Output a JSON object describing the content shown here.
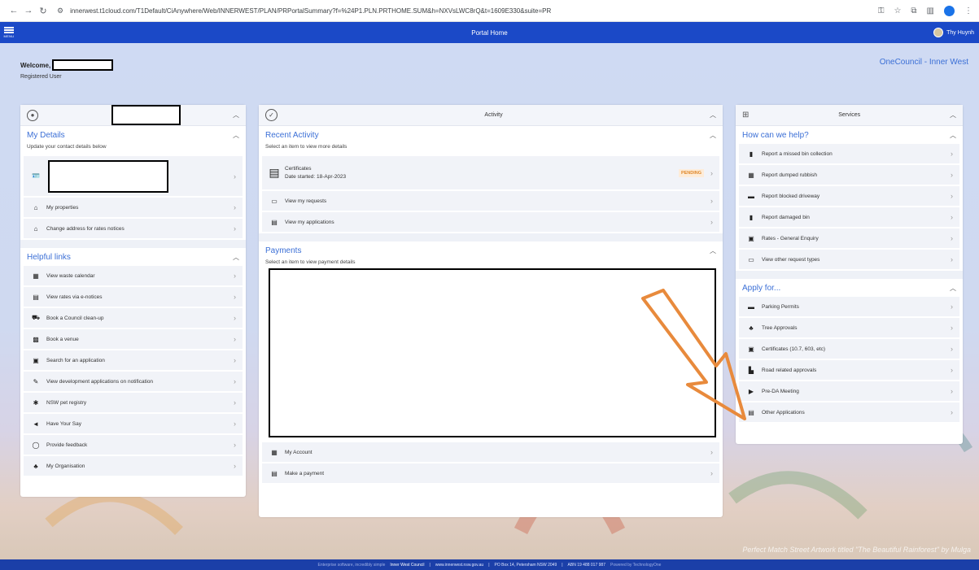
{
  "browser": {
    "url": "innerwest.t1cloud.com/T1Default/CiAnywhere/Web/INNERWEST/PLAN/PRPortalSummary?f=%24P1.PLN.PRTHOME.SUM&h=NXVsLWC8rQ&t=1609E330&suite=PR",
    "back_icon": "back-arrow-icon",
    "forward_icon": "forward-arrow-icon",
    "reload_icon": "reload-icon"
  },
  "appbar": {
    "menu_label": "MENU",
    "title": "Portal Home",
    "user_name": "Thy Huynh"
  },
  "welcome": {
    "greeting": "Welcome,",
    "role": "Registered User"
  },
  "brand": "OneCouncil - Inner West",
  "left": {
    "my_details": {
      "title": "My Details",
      "subtitle": "Update your contact details below",
      "items": [
        {
          "label": "My properties",
          "icon": "house-icon"
        },
        {
          "label": "Change address for rates notices",
          "icon": "house-move-icon"
        }
      ]
    },
    "helpful_links": {
      "title": "Helpful links",
      "items": [
        {
          "label": "View waste calendar",
          "icon": "calendar-icon"
        },
        {
          "label": "View rates via e-notices",
          "icon": "enotice-icon"
        },
        {
          "label": "Book a Council clean-up",
          "icon": "truck-icon"
        },
        {
          "label": "Book a venue",
          "icon": "venue-icon"
        },
        {
          "label": "Search for an application",
          "icon": "document-search-icon"
        },
        {
          "label": "View development applications on notification",
          "icon": "edit-icon"
        },
        {
          "label": "NSW pet registry",
          "icon": "paw-icon"
        },
        {
          "label": "Have Your Say",
          "icon": "megaphone-icon"
        },
        {
          "label": "Provide feedback",
          "icon": "chat-icon"
        },
        {
          "label": "My Organisation",
          "icon": "organisation-icon"
        }
      ]
    }
  },
  "middle": {
    "panel_title": "Activity",
    "recent": {
      "title": "Recent Activity",
      "subtitle": "Select an item to view more details",
      "certificate_title": "Certificates",
      "certificate_date": "Date started: 18-Apr-2023",
      "certificate_status": "PENDING",
      "items": [
        {
          "label": "View my requests",
          "icon": "requests-icon"
        },
        {
          "label": "View my applications",
          "icon": "applications-icon"
        }
      ]
    },
    "payments": {
      "title": "Payments",
      "subtitle": "Select an item to view payment details",
      "items": [
        {
          "label": "My Account",
          "icon": "account-icon"
        },
        {
          "label": "Make a payment",
          "icon": "payment-icon"
        }
      ]
    }
  },
  "right": {
    "panel_title": "Services",
    "help": {
      "title": "How can we help?",
      "items": [
        {
          "label": "Report a missed bin collection",
          "icon": "bin-icon"
        },
        {
          "label": "Report dumped rubbish",
          "icon": "rubbish-icon"
        },
        {
          "label": "Report blocked driveway",
          "icon": "car-icon"
        },
        {
          "label": "Report damaged bin",
          "icon": "damaged-bin-icon"
        },
        {
          "label": "Rates - General Enquiry",
          "icon": "rates-icon"
        },
        {
          "label": "View other request types",
          "icon": "request-types-icon"
        }
      ]
    },
    "apply": {
      "title": "Apply for...",
      "items": [
        {
          "label": "Parking Permits",
          "icon": "car-icon"
        },
        {
          "label": "Tree Approvals",
          "icon": "tree-icon"
        },
        {
          "label": "Certificates (10.7, 603, etc)",
          "icon": "certificate-icon"
        },
        {
          "label": "Road related approvals",
          "icon": "road-icon"
        },
        {
          "label": "Pre-DA Meeting",
          "icon": "meeting-icon"
        },
        {
          "label": "Other Applications",
          "icon": "applications-icon"
        }
      ]
    }
  },
  "footer": {
    "tagline": "Enterprise software, incredibly simple",
    "council": "Inner West Council",
    "website": "www.innerwest.nsw.gov.au",
    "address": "PO Box 14, Petersham NSW 2049",
    "abn": "ABN  19 488 017 987",
    "powered": "Powered by TechnologyOne"
  },
  "artwork_credit": "Perfect Match Street Artwork titled \"The Beautiful Rainforest\" by Mulga",
  "colors": {
    "app_bar": "#1b49c7",
    "link_blue": "#3b6fd6",
    "pending": "#e0882a",
    "annotation_arrow": "#e88a3c"
  }
}
